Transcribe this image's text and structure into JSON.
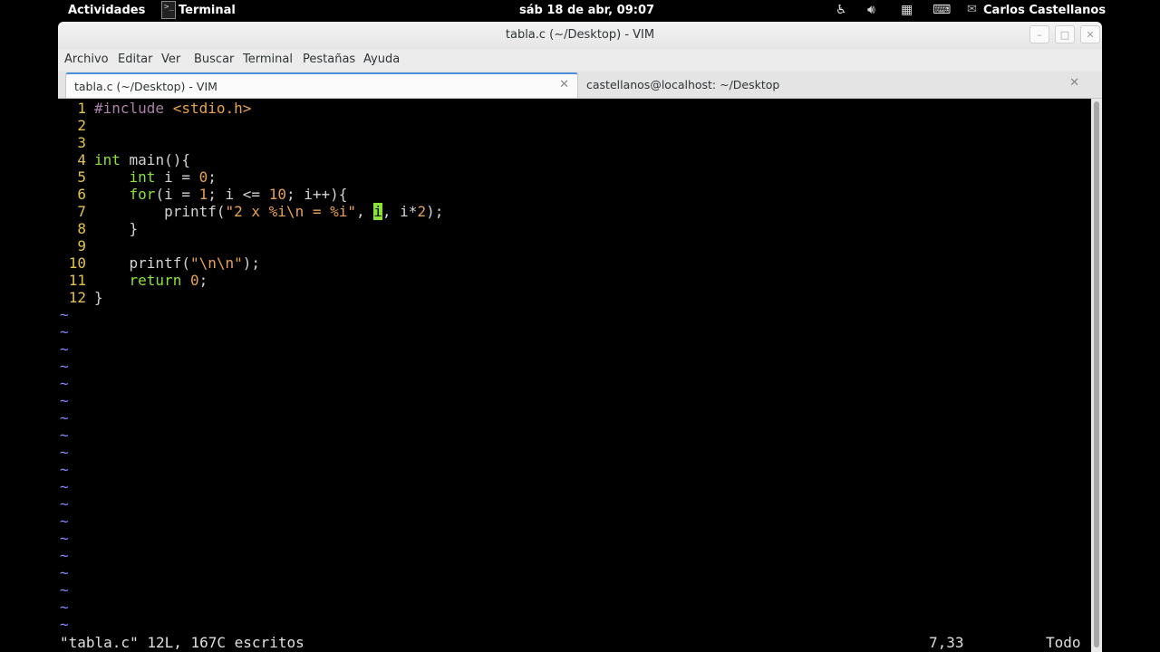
{
  "topbar": {
    "activities": "Actividades",
    "app_name": "Terminal",
    "clock": "sáb 18 de abr, 09:07",
    "user": "Carlos Castellanos"
  },
  "window": {
    "title": "tabla.c (~/Desktop) - VIM",
    "menu": [
      "Archivo",
      "Editar",
      "Ver",
      "Buscar",
      "Terminal",
      "Pestañas",
      "Ayuda"
    ],
    "tabs": [
      {
        "label": "tabla.c (~/Desktop) - VIM",
        "active": true
      },
      {
        "label": "castellanos@localhost: ~/Desktop",
        "active": false
      }
    ]
  },
  "editor": {
    "lines": [
      {
        "n": "1",
        "segs": [
          {
            "t": "#include ",
            "c": "pre"
          },
          {
            "t": "<stdio.h>",
            "c": "str"
          }
        ]
      },
      {
        "n": "2",
        "segs": []
      },
      {
        "n": "3",
        "segs": []
      },
      {
        "n": "4",
        "segs": [
          {
            "t": "int",
            "c": "kw"
          },
          {
            "t": " main(){",
            "c": ""
          }
        ]
      },
      {
        "n": "5",
        "segs": [
          {
            "t": "    ",
            "c": ""
          },
          {
            "t": "int",
            "c": "kw"
          },
          {
            "t": " i = ",
            "c": ""
          },
          {
            "t": "0",
            "c": "num"
          },
          {
            "t": ";",
            "c": ""
          }
        ]
      },
      {
        "n": "6",
        "segs": [
          {
            "t": "    ",
            "c": ""
          },
          {
            "t": "for",
            "c": "kw"
          },
          {
            "t": "(i = ",
            "c": ""
          },
          {
            "t": "1",
            "c": "num"
          },
          {
            "t": "; i <= ",
            "c": ""
          },
          {
            "t": "10",
            "c": "num"
          },
          {
            "t": "; i++){",
            "c": ""
          }
        ]
      },
      {
        "n": "7",
        "segs": [
          {
            "t": "        printf(",
            "c": ""
          },
          {
            "t": "\"2 x %i\\n = %i\"",
            "c": "str"
          },
          {
            "t": ", ",
            "c": ""
          },
          {
            "t": "i",
            "c": "cur"
          },
          {
            "t": ", i*",
            "c": ""
          },
          {
            "t": "2",
            "c": "num"
          },
          {
            "t": ");",
            "c": ""
          }
        ]
      },
      {
        "n": "8",
        "segs": [
          {
            "t": "    }",
            "c": ""
          }
        ]
      },
      {
        "n": "9",
        "segs": []
      },
      {
        "n": "10",
        "segs": [
          {
            "t": "    printf(",
            "c": ""
          },
          {
            "t": "\"\\n\\n\"",
            "c": "str"
          },
          {
            "t": ");",
            "c": ""
          }
        ]
      },
      {
        "n": "11",
        "segs": [
          {
            "t": "    ",
            "c": ""
          },
          {
            "t": "return",
            "c": "kw"
          },
          {
            "t": " ",
            "c": ""
          },
          {
            "t": "0",
            "c": "num"
          },
          {
            "t": ";",
            "c": ""
          }
        ]
      },
      {
        "n": "12",
        "segs": [
          {
            "t": "}",
            "c": ""
          }
        ]
      }
    ],
    "empty_line_marker": "~",
    "empty_line_count": 19,
    "status_message": "\"tabla.c\" 12L, 167C escritos",
    "cursor_position": "7,33",
    "scroll_percent": "Todo"
  }
}
